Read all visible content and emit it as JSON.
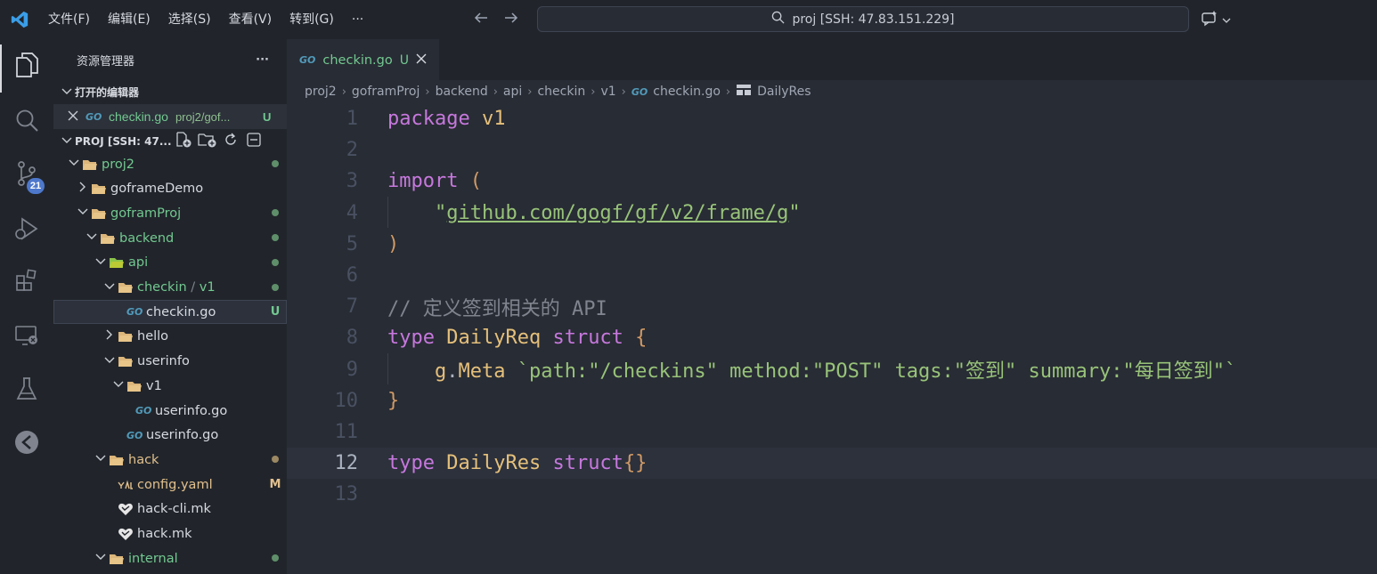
{
  "titlebar": {
    "menus": [
      "文件(F)",
      "编辑(E)",
      "选择(S)",
      "查看(V)",
      "转到(G)",
      "···"
    ],
    "search_text": "proj [SSH: 47.83.151.229]"
  },
  "activitybar": {
    "items": [
      "explorer-icon",
      "search-icon",
      "source-control-icon",
      "run-debug-icon",
      "extensions-icon",
      "remote-explorer-icon",
      "testing-icon",
      "gitlens-icon"
    ],
    "source_control_badge": "21"
  },
  "sidebar": {
    "title": "资源管理器",
    "more": "···",
    "open_editors_label": "打开的编辑器",
    "open_editor": {
      "name": "checkin.go",
      "path": "proj2/gof...",
      "status": "U"
    },
    "workspace_label": "PROJ [SSH: 47...",
    "tree": [
      {
        "name": "proj2",
        "indent": 1,
        "expanded": true,
        "folder": true,
        "color": "green",
        "status": "dot-green"
      },
      {
        "name": "goframeDemo",
        "indent": 2,
        "expanded": false,
        "folder": true,
        "color": "plain",
        "status": ""
      },
      {
        "name": "goframProj",
        "indent": 2,
        "expanded": true,
        "folder": true,
        "color": "green",
        "status": "dot-green"
      },
      {
        "name": "backend",
        "indent": 3,
        "expanded": true,
        "folder": true,
        "color": "green",
        "status": "dot-green"
      },
      {
        "name": "api",
        "indent": 4,
        "expanded": true,
        "folder": true,
        "color": "green",
        "status": "dot-green",
        "special": true
      },
      {
        "name": "checkin",
        "name2": "v1",
        "indent": 5,
        "expanded": true,
        "folder": true,
        "color": "green",
        "status": "dot-green"
      },
      {
        "name": "checkin.go",
        "indent": 6,
        "file": "go",
        "color": "plain",
        "status": "U",
        "selected": true
      },
      {
        "name": "hello",
        "indent": 5,
        "expanded": false,
        "folder": true,
        "color": "plain",
        "status": ""
      },
      {
        "name": "userinfo",
        "indent": 5,
        "expanded": true,
        "folder": true,
        "color": "plain",
        "status": ""
      },
      {
        "name": "v1",
        "indent": 6,
        "expanded": true,
        "folder": true,
        "color": "plain",
        "status": ""
      },
      {
        "name": "userinfo.go",
        "indent": 7,
        "file": "go",
        "color": "plain",
        "status": ""
      },
      {
        "name": "userinfo.go",
        "indent": 6,
        "file": "go",
        "color": "plain",
        "status": ""
      },
      {
        "name": "hack",
        "indent": 4,
        "expanded": true,
        "folder": true,
        "color": "yellow",
        "status": "dot-yellow"
      },
      {
        "name": "config.yaml",
        "indent": 5,
        "file": "yaml",
        "color": "yellow",
        "status": "M"
      },
      {
        "name": "hack-cli.mk",
        "indent": 5,
        "file": "mk",
        "color": "plain",
        "status": ""
      },
      {
        "name": "hack.mk",
        "indent": 5,
        "file": "mk",
        "color": "plain",
        "status": ""
      },
      {
        "name": "internal",
        "indent": 4,
        "expanded": true,
        "folder": true,
        "color": "green",
        "status": "dot-green"
      }
    ]
  },
  "tab": {
    "name": "checkin.go",
    "status": "U"
  },
  "breadcrumb": [
    "proj2",
    "goframProj",
    "backend",
    "api",
    "checkin",
    "v1",
    "checkin.go",
    "DailyRes"
  ],
  "editor": {
    "current_line": 12,
    "lines": [
      [
        [
          "kw",
          "package "
        ],
        [
          "ty",
          "v1"
        ]
      ],
      [],
      [
        [
          "kw",
          "import "
        ],
        [
          "br",
          "("
        ]
      ],
      [
        [
          "pl",
          "    "
        ],
        [
          "str",
          "\""
        ],
        [
          "str-ul",
          "github.com/gogf/gf/v2/frame/g"
        ],
        [
          "str",
          "\""
        ]
      ],
      [
        [
          "br",
          ")"
        ]
      ],
      [],
      [
        [
          "cm",
          "// 定义签到相关的 API"
        ]
      ],
      [
        [
          "kw",
          "type "
        ],
        [
          "ty",
          "DailyReq "
        ],
        [
          "kw",
          "struct "
        ],
        [
          "br",
          "{"
        ]
      ],
      [
        [
          "pl",
          "    "
        ],
        [
          "ty",
          "g"
        ],
        [
          "pl",
          "."
        ],
        [
          "ty",
          "Meta "
        ],
        [
          "str",
          "`path:\"/checkins\" method:\"POST\" tags:\"签到\" summary:\"每日签到\"`"
        ]
      ],
      [
        [
          "br",
          "}"
        ]
      ],
      [],
      [
        [
          "kw",
          "type "
        ],
        [
          "ty",
          "DailyRes "
        ],
        [
          "kw",
          "struct"
        ],
        [
          "br",
          "{}"
        ]
      ],
      []
    ]
  }
}
